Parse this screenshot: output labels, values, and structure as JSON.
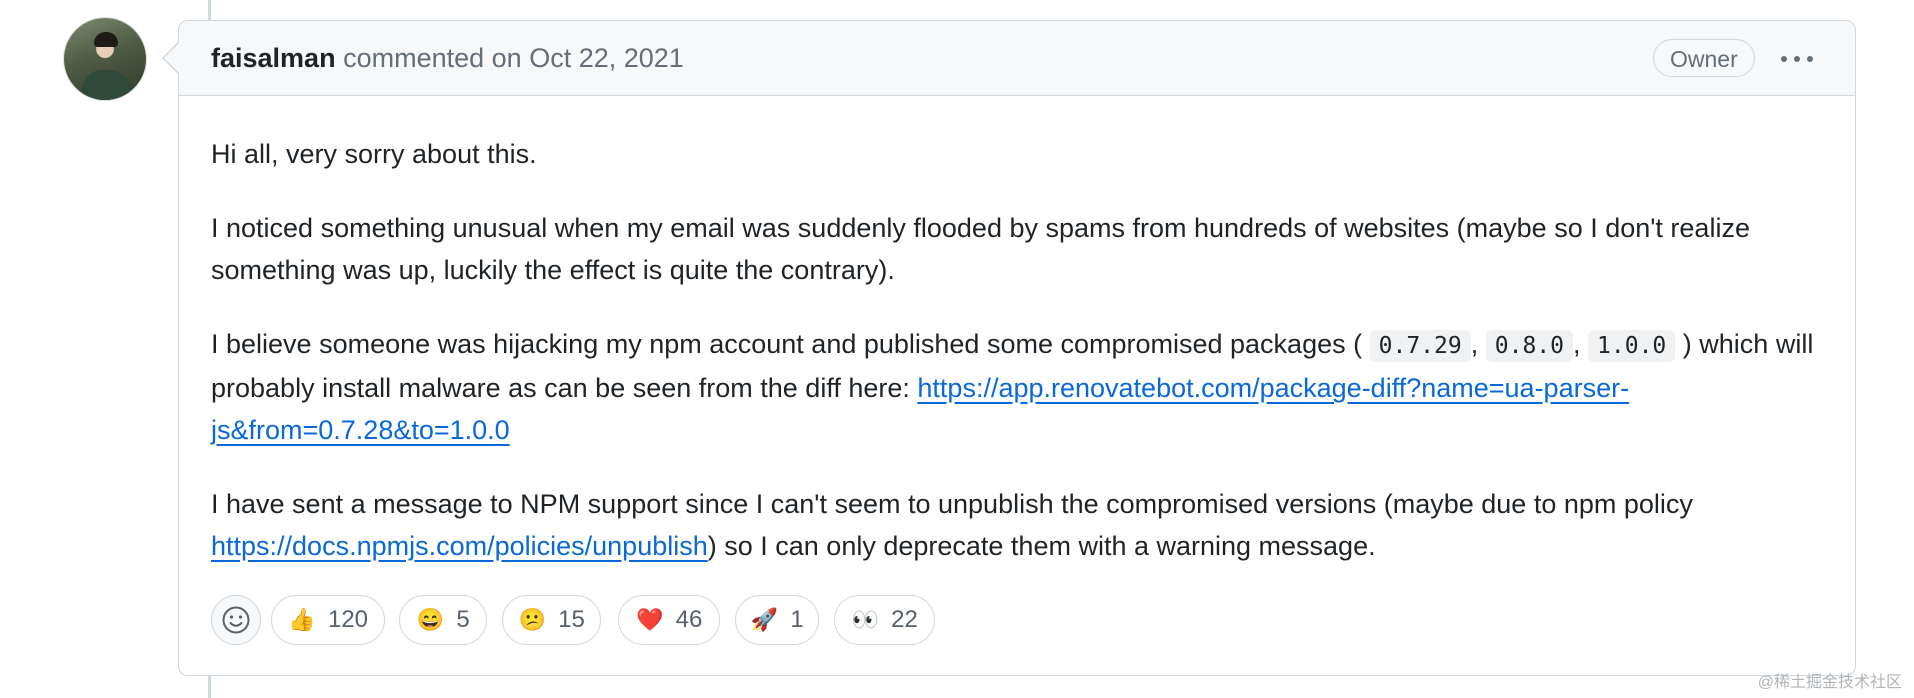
{
  "comment": {
    "author": "faisalman",
    "action": "commented on",
    "date": "Oct 22, 2021",
    "badge": "Owner",
    "paragraphs": {
      "p1": "Hi all, very sorry about this.",
      "p2": "I noticed something unusual when my email was suddenly flooded by spams from hundreds of websites (maybe so I don't realize something was up, luckily the effect is quite the contrary).",
      "p3_text1": "I believe someone was hijacking my npm account and published some compromised packages (",
      "p3_code1": "0.7.29",
      "p3_sep1": ",",
      "p3_code2": "0.8.0",
      "p3_sep2": ",",
      "p3_code3": "1.0.0",
      "p3_text2": ") which will probably install malware as can be seen from the diff here:",
      "p3_link": "https://app.renovatebot.com/package-diff?name=ua-parser-js&from=0.7.28&to=1.0.0",
      "p4_text1": "I have sent a message to NPM support since I can't seem to unpublish the compromised versions (maybe due to npm policy",
      "p4_link": "https://docs.npmjs.com/policies/unpublish",
      "p4_text2": ") so I can only deprecate them with a warning message."
    }
  },
  "reactions": [
    {
      "emoji": "👍",
      "count": "120",
      "icon": "thumbs-up-icon"
    },
    {
      "emoji": "😄",
      "count": "5",
      "icon": "laugh-icon"
    },
    {
      "emoji": "😕",
      "count": "15",
      "icon": "confused-icon"
    },
    {
      "emoji": "❤️",
      "count": "46",
      "icon": "heart-icon"
    },
    {
      "emoji": "🚀",
      "count": "1",
      "icon": "rocket-icon"
    },
    {
      "emoji": "👀",
      "count": "22",
      "icon": "eyes-icon"
    }
  ],
  "watermark": "@稀土掘金技术社区",
  "colors": {
    "link": "#0969da",
    "border": "#d0d7de",
    "header_bg": "#f6f8fa"
  }
}
